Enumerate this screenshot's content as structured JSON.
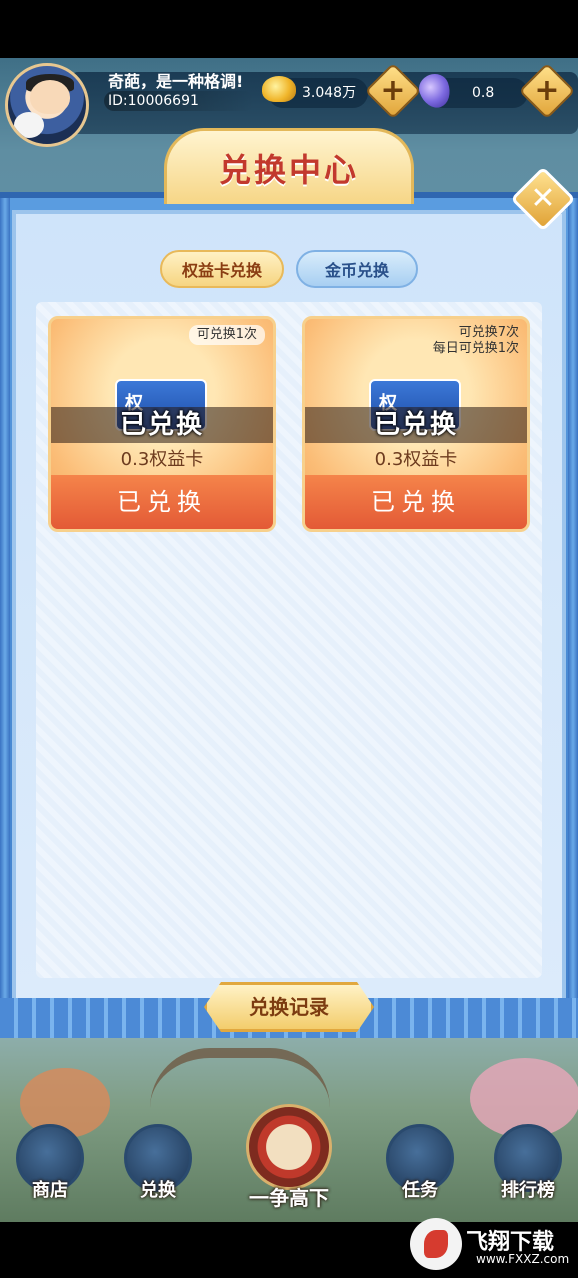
{
  "user": {
    "nickname": "奇葩，是一种格调!",
    "id_text": "ID:10006691"
  },
  "resources": {
    "gold": "3.048万",
    "gem": "0.8",
    "plus": "+"
  },
  "modal": {
    "title": "兑换中心",
    "close": "✕",
    "tabs": [
      {
        "label": "权益卡兑换",
        "active": true
      },
      {
        "label": "金币兑换",
        "active": false
      }
    ],
    "cards": [
      {
        "limit": "可兑换1次",
        "art": "权",
        "status": "已兑换",
        "name": "0.3权益卡",
        "button": "已兑换"
      },
      {
        "limit_line1": "可兑换7次",
        "limit_line2": "每日可兑换1次",
        "art": "权",
        "status": "已兑换",
        "name": "0.3权益卡",
        "button": "已兑换"
      }
    ],
    "record_button": "兑换记录"
  },
  "nav": [
    {
      "label": "商店"
    },
    {
      "label": "兑换"
    },
    {
      "label": "一争高下"
    },
    {
      "label": "任务"
    },
    {
      "label": "排行榜"
    }
  ],
  "watermark": {
    "brand": "飞翔下载",
    "url": "www.FXXZ.com"
  },
  "colors": {
    "accent_red": "#c2392d",
    "button_orange": "#e35a36",
    "gold": "#f3cd6c",
    "frame_blue": "#3f7fcc"
  }
}
